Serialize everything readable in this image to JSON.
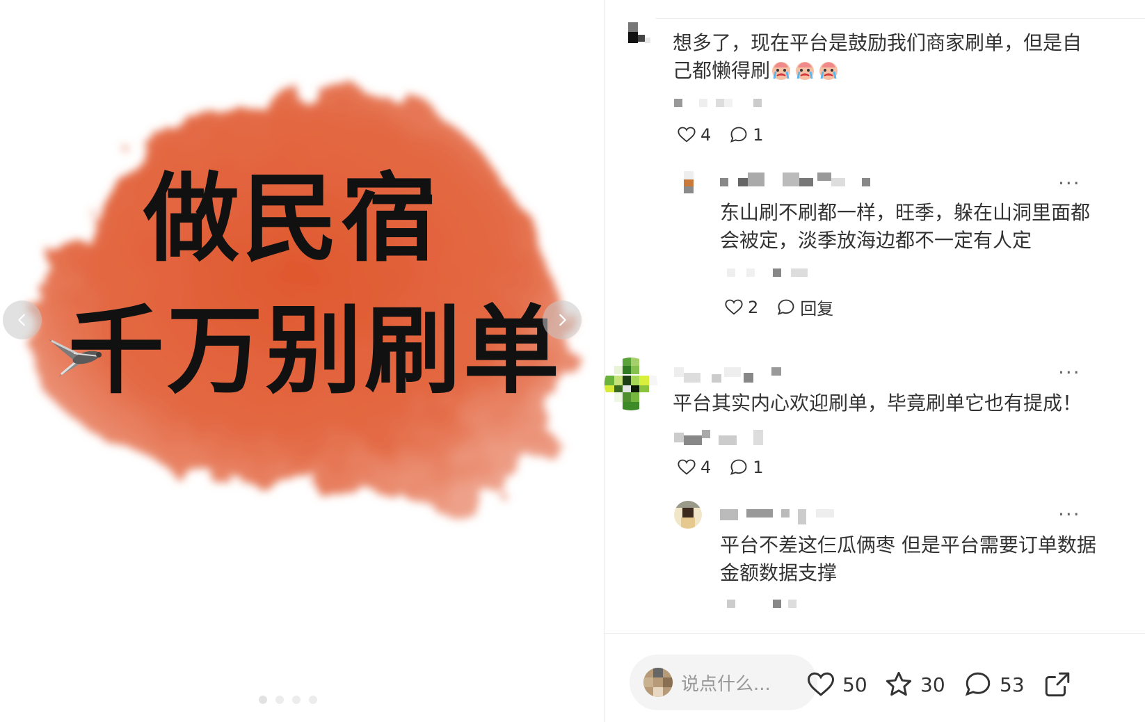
{
  "cover": {
    "line1": "做民宿",
    "line2": "千万别刷单",
    "brush_color": "#e1623b"
  },
  "carousel": {
    "prev_icon": "chevron-left-icon",
    "next_icon": "chevron-right-icon",
    "dot_count": 4,
    "active_index": 0
  },
  "comments": [
    {
      "text": "想多了，现在平台是鼓励我们商家刷单，但是自己都懒得刷",
      "emoji": [
        "crying-face-emoji",
        "crying-face-emoji",
        "crying-face-emoji"
      ],
      "likes": "4",
      "replies": "1",
      "sub": {
        "text": "东山刷不刷都一样，旺季，躲在山洞里面都会被定，淡季放海边都不一定有人定",
        "likes": "2",
        "reply_label": "回复",
        "more": "···"
      }
    },
    {
      "text": "平台其实内心欢迎刷单，毕竟刷单它也有提成！",
      "likes": "4",
      "replies": "1",
      "more": "···",
      "sub": {
        "text": "平台不差这仨瓜俩枣 但是平台需要订单数据金额数据支撑",
        "more": "···"
      }
    }
  ],
  "bottom_bar": {
    "placeholder": "说点什么...",
    "likes": "50",
    "stars": "30",
    "comments": "53"
  },
  "colors": {
    "accent_brush": "#e1623b",
    "text": "#333333",
    "muted": "#999999"
  }
}
